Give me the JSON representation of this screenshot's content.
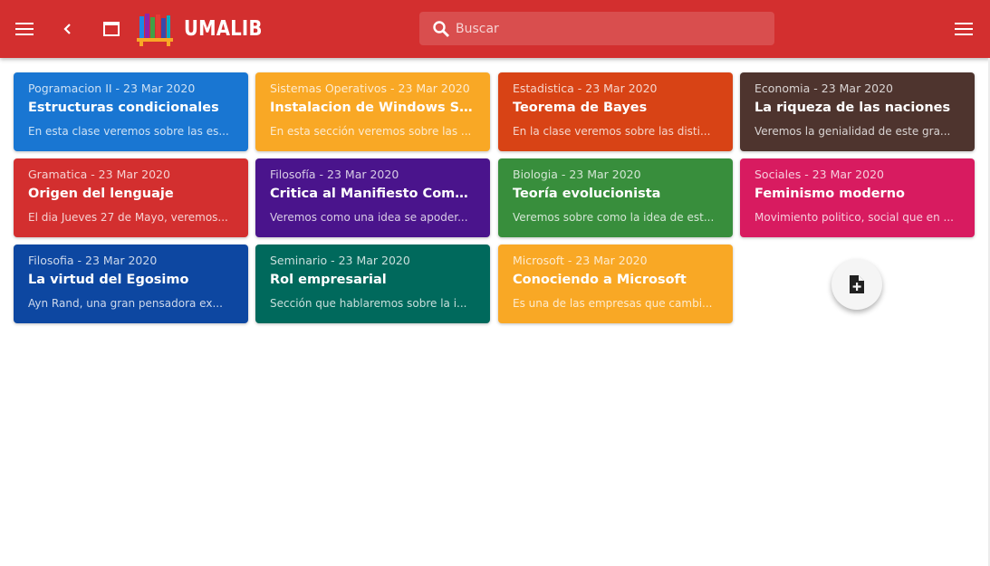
{
  "appbar": {
    "brand": "UMALIB",
    "menu_icon": "menu-icon",
    "back_icon": "chevron-left-icon",
    "window_icon": "window-icon",
    "logo_icon": "books-logo",
    "right_menu_icon": "menu-icon",
    "color": "#d32f2f"
  },
  "search": {
    "placeholder": "Buscar",
    "value": "",
    "icon": "search-icon"
  },
  "cards": [
    {
      "subject": "Pogramacion II",
      "date": "23 Mar 2020",
      "meta": "Pogramacion II - 23 Mar 2020",
      "title": "Estructuras condicionales",
      "desc": "En esta clase veremos sobre las es...",
      "color": "#1976d2"
    },
    {
      "subject": "Sistemas Operativos",
      "date": "23 Mar 2020",
      "meta": "Sistemas Operativos - 23 Mar 2020",
      "title": "Instalacion de Windows Server",
      "desc": "En esta sección veremos sobre las ...",
      "color": "#f9a825"
    },
    {
      "subject": "Estadistica",
      "date": "23 Mar 2020",
      "meta": "Estadistica - 23 Mar 2020",
      "title": "Teorema de Bayes",
      "desc": "En la clase veremos sobre las disti...",
      "color": "#d84315"
    },
    {
      "subject": "Economia",
      "date": "23 Mar 2020",
      "meta": "Economia - 23 Mar 2020",
      "title": "La riqueza de las naciones",
      "desc": "Veremos la genialidad de este gra...",
      "color": "#4e342e"
    },
    {
      "subject": "Gramatica",
      "date": "23 Mar 2020",
      "meta": "Gramatica - 23 Mar 2020",
      "title": "Origen del lenguaje",
      "desc": "El dia Jueves 27 de Mayo, veremos...",
      "color": "#d32f2f"
    },
    {
      "subject": "Filosofía",
      "date": "23 Mar 2020",
      "meta": "Filosofía - 23 Mar 2020",
      "title": "Critica al Manifiesto Comunis...",
      "desc": "Veremos como una idea se apoder...",
      "color": "#4a148c"
    },
    {
      "subject": "Biologia",
      "date": "23 Mar 2020",
      "meta": "Biologia - 23 Mar 2020",
      "title": "Teoría evolucionista",
      "desc": "Veremos sobre como la idea de est...",
      "color": "#388e3c"
    },
    {
      "subject": "Sociales",
      "date": "23 Mar 2020",
      "meta": "Sociales - 23 Mar 2020",
      "title": "Feminismo moderno",
      "desc": "Movimiento politico, social que en ...",
      "color": "#d81b60"
    },
    {
      "subject": "Filosofia",
      "date": "23 Mar 2020",
      "meta": "Filosofia - 23 Mar 2020",
      "title": "La virtud del Egosimo",
      "desc": "Ayn Rand, una gran pensadora ex...",
      "color": "#0d47a1"
    },
    {
      "subject": "Seminario",
      "date": "23 Mar 2020",
      "meta": "Seminario - 23 Mar 2020",
      "title": "Rol empresarial",
      "desc": "Sección que hablaremos sobre la i...",
      "color": "#00695c"
    },
    {
      "subject": "Microsoft",
      "date": "23 Mar 2020",
      "meta": "Microsoft - 23 Mar 2020",
      "title": "Conociendo a Microsoft",
      "desc": "Es una de las empresas que cambi...",
      "color": "#f9a825"
    }
  ],
  "fab": {
    "icon": "note-add-icon"
  }
}
